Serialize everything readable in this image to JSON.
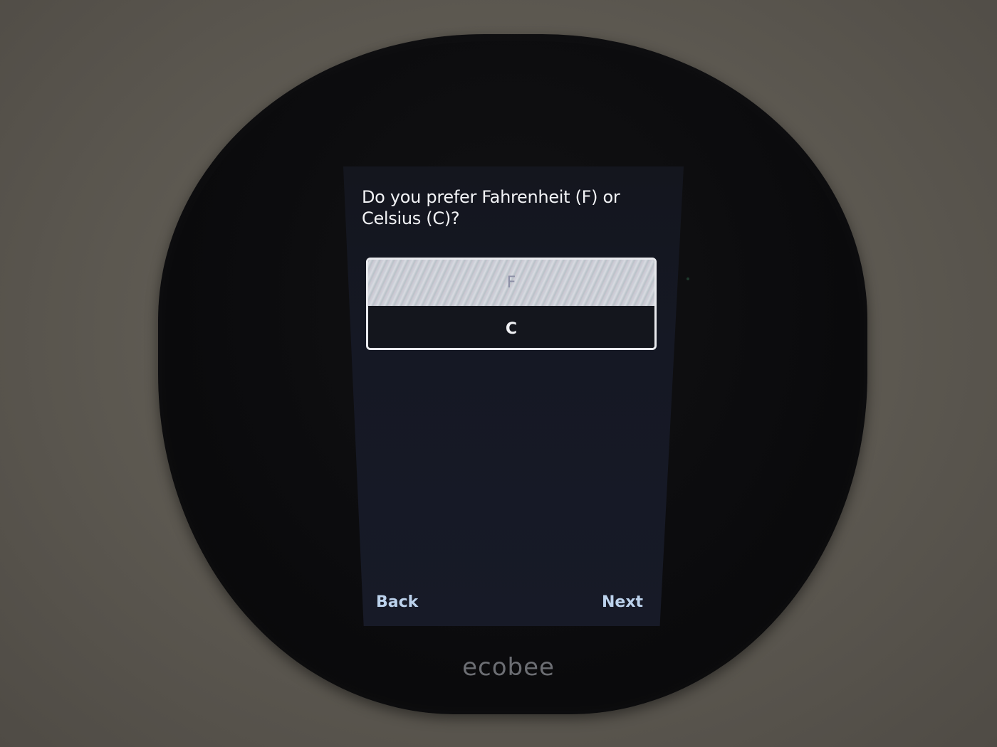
{
  "setup": {
    "question": "Do you prefer Fahrenheit (F) or Celsius (C)?",
    "options": [
      {
        "label": "F",
        "selected": true
      },
      {
        "label": "C",
        "selected": false
      }
    ],
    "back_label": "Back",
    "next_label": "Next"
  },
  "device": {
    "brand": "ecobee"
  },
  "colors": {
    "screen_background": "#151824",
    "nav_accent": "#bcd2ec",
    "device_body": "#0b0b0d"
  }
}
